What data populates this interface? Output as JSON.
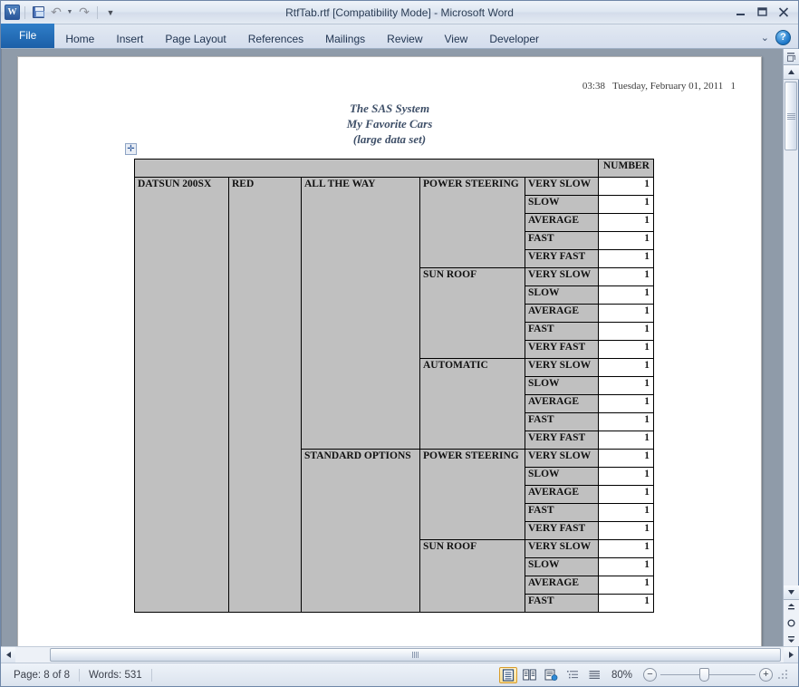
{
  "window": {
    "title": "RtfTab.rtf [Compatibility Mode]  -  Microsoft Word",
    "minimize_label": "Minimize",
    "restore_label": "Restore Down",
    "close_label": "Close"
  },
  "quick_access": {
    "logo_label": "W",
    "save_label": "Save",
    "undo_label": "Undo",
    "redo_label": "Repeat",
    "customize_label": "Customize Quick Access Toolbar"
  },
  "ribbon": {
    "tabs": [
      {
        "label": "File",
        "active": true
      },
      {
        "label": "Home",
        "active": false
      },
      {
        "label": "Insert",
        "active": false
      },
      {
        "label": "Page Layout",
        "active": false
      },
      {
        "label": "References",
        "active": false
      },
      {
        "label": "Mailings",
        "active": false
      },
      {
        "label": "Review",
        "active": false
      },
      {
        "label": "View",
        "active": false
      },
      {
        "label": "Developer",
        "active": false
      }
    ],
    "minimize_ribbon_label": "Minimize the Ribbon",
    "help_label": "?"
  },
  "document": {
    "header_line": "03:38   Tuesday, February 01, 2011   1",
    "title_lines": [
      "The SAS System",
      "My Favorite Cars",
      "(large data set)"
    ],
    "table_move_handle": "✛",
    "table": {
      "header": {
        "blank_span_label": "",
        "number_label": "NUMBER"
      },
      "rows": [
        {
          "car": "DATSUN 200SX",
          "color": "RED",
          "options": "ALL THE WAY",
          "feature": "POWER STEERING",
          "speed": "VERY SLOW",
          "number": "1"
        },
        {
          "car": "",
          "color": "",
          "options": "",
          "feature": "",
          "speed": "SLOW",
          "number": "1"
        },
        {
          "car": "",
          "color": "",
          "options": "",
          "feature": "",
          "speed": "AVERAGE",
          "number": "1"
        },
        {
          "car": "",
          "color": "",
          "options": "",
          "feature": "",
          "speed": "FAST",
          "number": "1"
        },
        {
          "car": "",
          "color": "",
          "options": "",
          "feature": "",
          "speed": "VERY FAST",
          "number": "1"
        },
        {
          "car": "",
          "color": "",
          "options": "",
          "feature": "SUN ROOF",
          "speed": "VERY SLOW",
          "number": "1"
        },
        {
          "car": "",
          "color": "",
          "options": "",
          "feature": "",
          "speed": "SLOW",
          "number": "1"
        },
        {
          "car": "",
          "color": "",
          "options": "",
          "feature": "",
          "speed": "AVERAGE",
          "number": "1"
        },
        {
          "car": "",
          "color": "",
          "options": "",
          "feature": "",
          "speed": "FAST",
          "number": "1"
        },
        {
          "car": "",
          "color": "",
          "options": "",
          "feature": "",
          "speed": "VERY FAST",
          "number": "1"
        },
        {
          "car": "",
          "color": "",
          "options": "",
          "feature": "AUTOMATIC",
          "speed": "VERY SLOW",
          "number": "1"
        },
        {
          "car": "",
          "color": "",
          "options": "",
          "feature": "",
          "speed": "SLOW",
          "number": "1"
        },
        {
          "car": "",
          "color": "",
          "options": "",
          "feature": "",
          "speed": "AVERAGE",
          "number": "1"
        },
        {
          "car": "",
          "color": "",
          "options": "",
          "feature": "",
          "speed": "FAST",
          "number": "1"
        },
        {
          "car": "",
          "color": "",
          "options": "",
          "feature": "",
          "speed": "VERY FAST",
          "number": "1"
        },
        {
          "car": "",
          "color": "",
          "options": "STANDARD OPTIONS",
          "feature": "POWER STEERING",
          "speed": "VERY SLOW",
          "number": "1"
        },
        {
          "car": "",
          "color": "",
          "options": "",
          "feature": "",
          "speed": "SLOW",
          "number": "1"
        },
        {
          "car": "",
          "color": "",
          "options": "",
          "feature": "",
          "speed": "AVERAGE",
          "number": "1"
        },
        {
          "car": "",
          "color": "",
          "options": "",
          "feature": "",
          "speed": "FAST",
          "number": "1"
        },
        {
          "car": "",
          "color": "",
          "options": "",
          "feature": "",
          "speed": "VERY FAST",
          "number": "1"
        },
        {
          "car": "",
          "color": "",
          "options": "",
          "feature": "SUN ROOF",
          "speed": "VERY SLOW",
          "number": "1"
        },
        {
          "car": "",
          "color": "",
          "options": "",
          "feature": "",
          "speed": "SLOW",
          "number": "1"
        },
        {
          "car": "",
          "color": "",
          "options": "",
          "feature": "",
          "speed": "AVERAGE",
          "number": "1"
        },
        {
          "car": "",
          "color": "",
          "options": "",
          "feature": "",
          "speed": "FAST",
          "number": "1"
        }
      ]
    }
  },
  "scrollbars": {
    "split_label": "Split",
    "up_arrow": "▲",
    "down_arrow": "▼",
    "previous_page": "⯅",
    "browse_object": "○",
    "next_page": "⯆",
    "left_arrow": "◀",
    "right_arrow": "▶"
  },
  "status_bar": {
    "page": "Page: 8 of 8",
    "words": "Words: 531",
    "views": [
      {
        "name": "print-layout",
        "label": "Print Layout",
        "active": true
      },
      {
        "name": "full-screen-reading",
        "label": "Full Screen Reading",
        "active": false
      },
      {
        "name": "web-layout",
        "label": "Web Layout",
        "active": false
      },
      {
        "name": "outline",
        "label": "Outline",
        "active": false
      },
      {
        "name": "draft",
        "label": "Draft",
        "active": false
      }
    ],
    "zoom_percent": "80%",
    "zoom_out_label": "−",
    "zoom_in_label": "+"
  },
  "colors": {
    "accent_blue": "#2f7ec8",
    "table_cell_gray": "#c0c0c0",
    "workspace_gray": "#8f9ba9",
    "active_view_border": "#d89c2a"
  }
}
